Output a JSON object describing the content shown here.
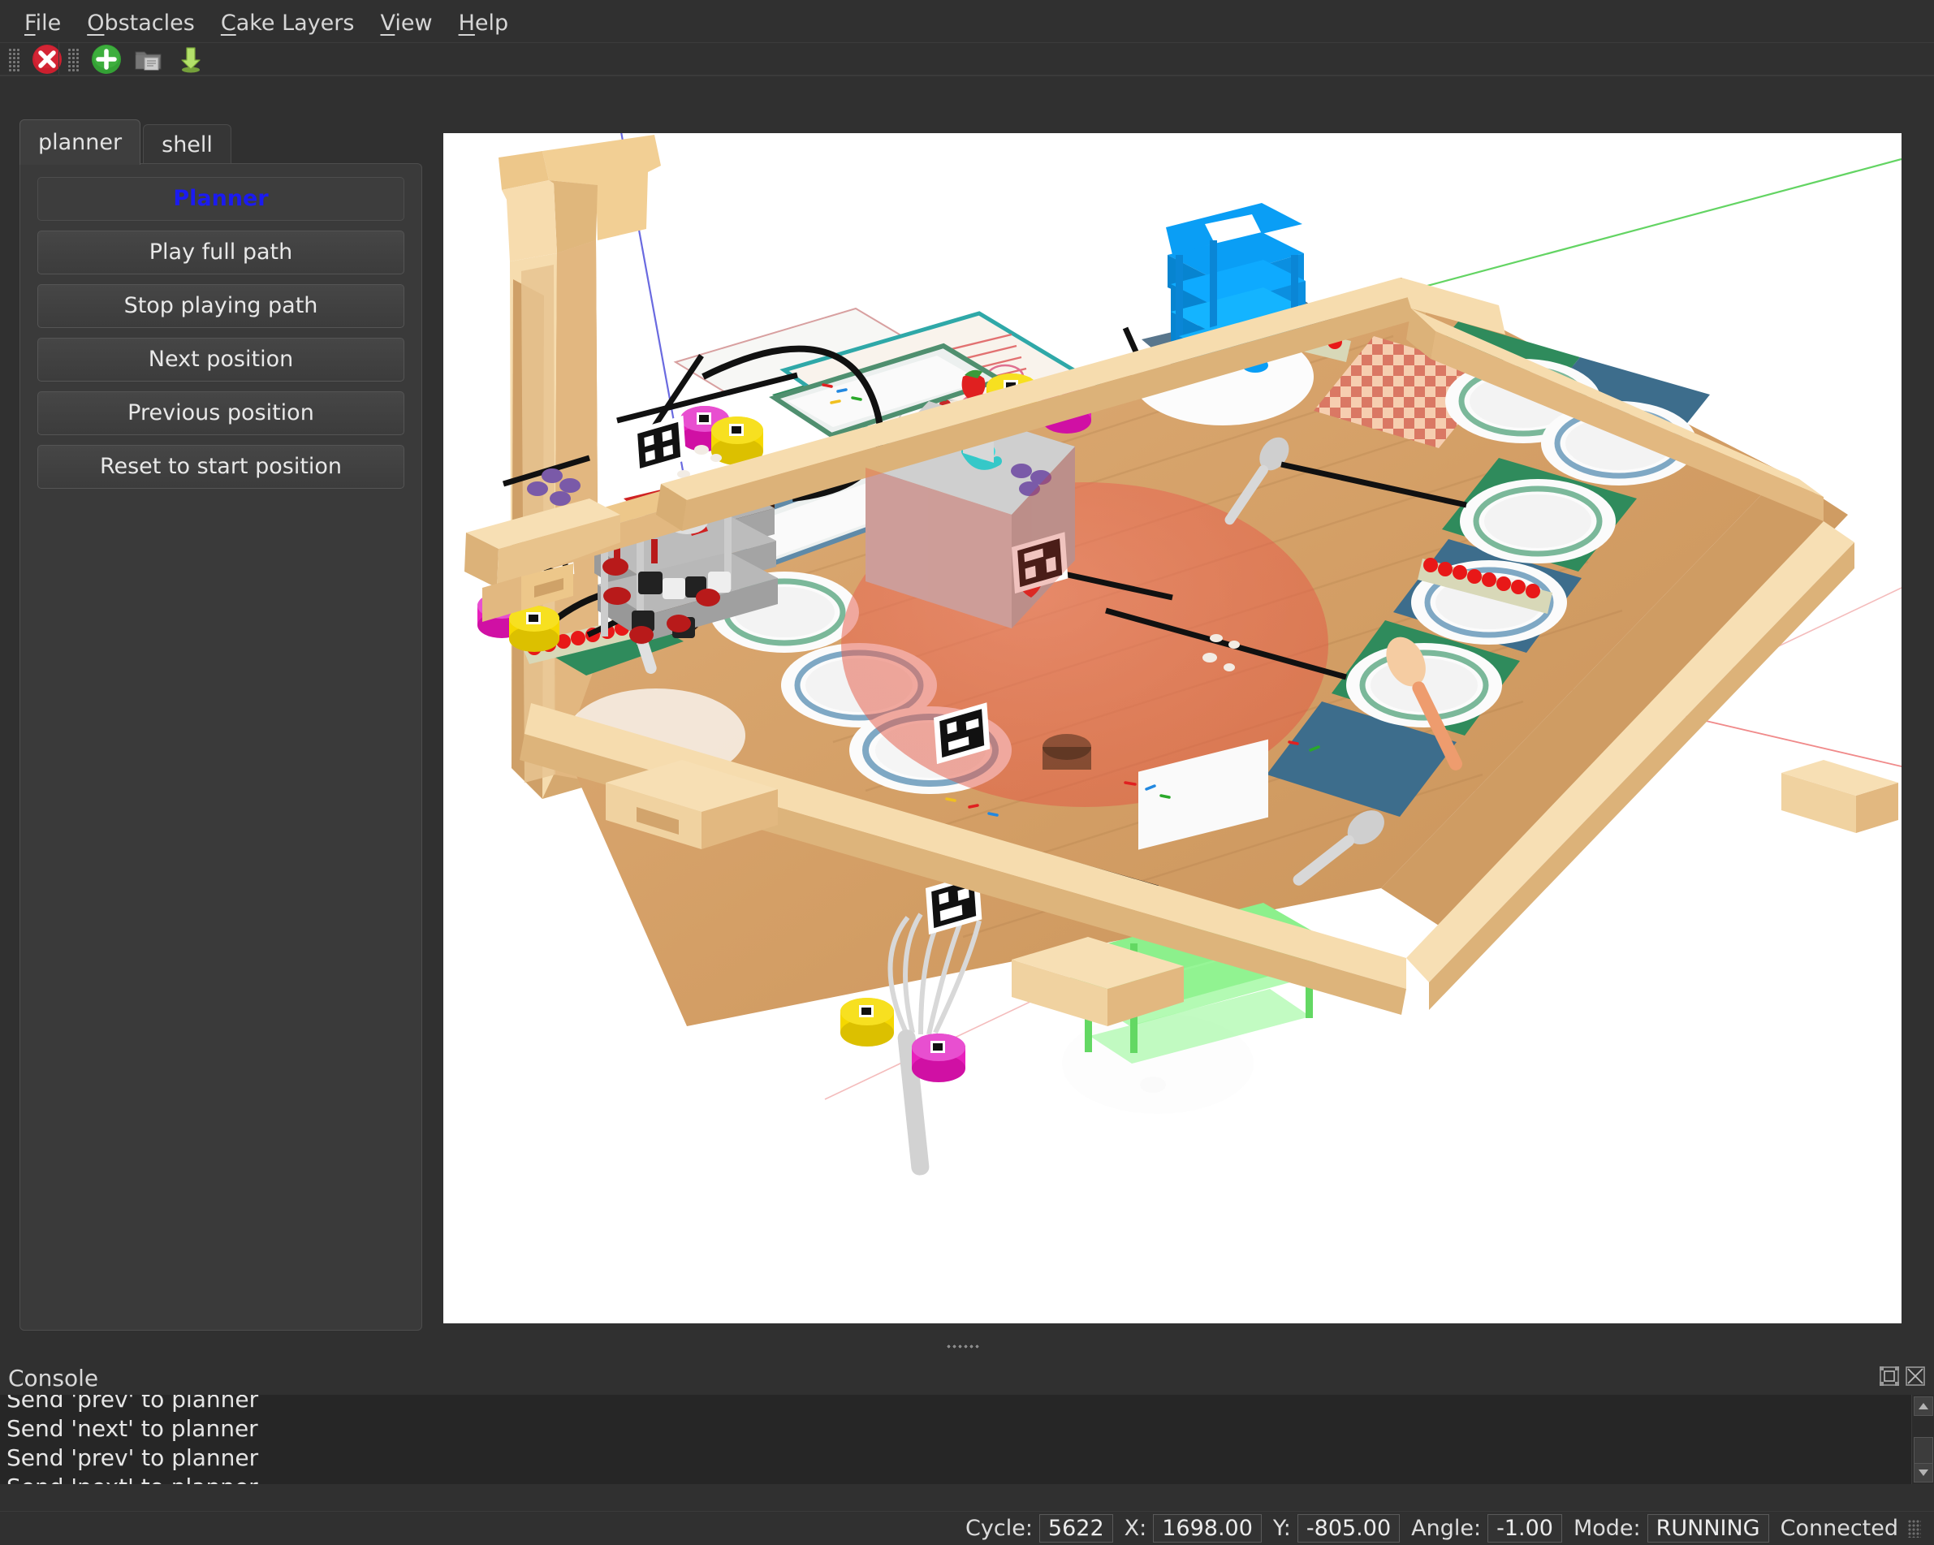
{
  "menubar": {
    "items": [
      {
        "label": "File",
        "mnemonic": "F"
      },
      {
        "label": "Obstacles",
        "mnemonic": "O"
      },
      {
        "label": "Cake Layers",
        "mnemonic": "C"
      },
      {
        "label": "View",
        "mnemonic": "V"
      },
      {
        "label": "Help",
        "mnemonic": "H"
      }
    ]
  },
  "toolbar": {
    "buttons": [
      {
        "name": "stop-button",
        "icon": "red-x-circle-icon"
      },
      {
        "name": "add-button",
        "icon": "green-plus-circle-icon"
      },
      {
        "name": "open-document-button",
        "icon": "folder-document-icon"
      },
      {
        "name": "download-button",
        "icon": "green-down-arrow-icon"
      }
    ]
  },
  "left_dock": {
    "tabs": [
      {
        "label": "planner",
        "active": true
      },
      {
        "label": "shell",
        "active": false
      }
    ],
    "planner": {
      "title": "Planner",
      "title_color": "#1b1bf0",
      "buttons": [
        "Play full path",
        "Stop playing path",
        "Next position",
        "Previous position",
        "Reset to start position"
      ]
    }
  },
  "console": {
    "title": "Console",
    "lines": [
      "Send 'prev' to planner",
      "Send 'next' to planner",
      "Send 'prev' to planner",
      "Send 'next' to planner"
    ],
    "header_icons": [
      {
        "name": "float-dock-icon"
      },
      {
        "name": "close-icon"
      }
    ]
  },
  "statusbar": {
    "cycle_label": "Cycle:",
    "cycle_value": "5622",
    "x_label": "X:",
    "x_value": "1698.00",
    "y_label": "Y:",
    "y_value": "-805.00",
    "angle_label": "Angle:",
    "angle_value": "-1.00",
    "mode_label": "Mode:",
    "mode_value": "RUNNING",
    "connection": "Connected"
  },
  "viewport": {
    "background": "#ffffff",
    "scene_name": "cake-competition-table-3d-view",
    "colors": {
      "table_wood_light": "#f7d9a6",
      "table_wood_mid": "#e0b97f",
      "table_wood_dark": "#c9a06a",
      "playfield_wood": "#d7a36c",
      "playfield_wood_dark": "#c08f5c",
      "blue_robot": "#0a9ef5",
      "grey_robot": "#a8a8a8",
      "green_robot": "#8cf08c",
      "cake_red": "#e8604c",
      "cake_yellow": "#f5d800",
      "cake_magenta": "#e81fbc",
      "cake_brown": "#4a2c1c",
      "plate_white": "#fbfbfb",
      "mat_green": "#2e8b57",
      "mat_blue": "#3c6e8f",
      "axis_red": "#ff4444",
      "axis_green": "#44cc44",
      "axis_blue": "#5555ff"
    },
    "objects": {
      "robots": [
        "blue-robot",
        "grey-robot",
        "green-robot"
      ],
      "cake_layers": [
        "yellow-layer",
        "magenta-layer",
        "brown-layer"
      ],
      "obstacle": "grey-box-obstacle",
      "markers": "aruco-markers"
    }
  }
}
